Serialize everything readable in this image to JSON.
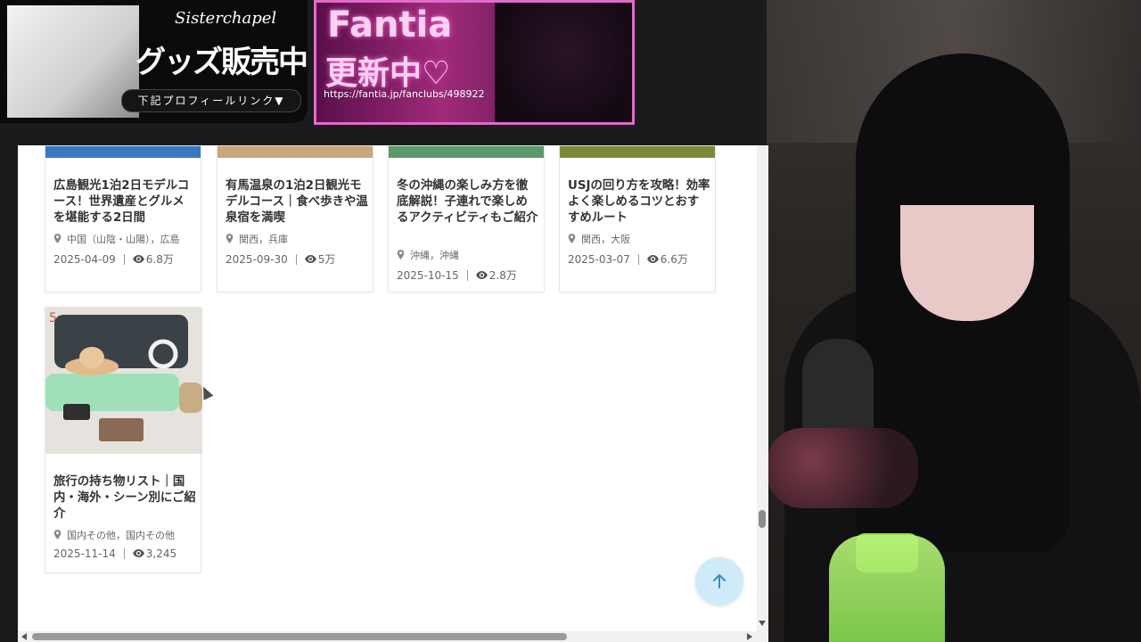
{
  "overlay": {
    "left_banner": {
      "brand": "Sisterchapel",
      "headline": "グッズ販売中",
      "link_text": "下記プロフィールリンク▼"
    },
    "right_banner": {
      "title": "Fantia",
      "subtitle": "更新中♡",
      "url": "https://fantia.jp/fanclubs/498922"
    }
  },
  "articles": [
    {
      "title": "広島観光1泊2日モデルコース！世界遺産とグルメを堪能する2日間",
      "location": "中国（山陰・山陽），広島",
      "date": "2025-04-09",
      "views": "6.8万",
      "strip_color": "#3a78c2"
    },
    {
      "title": "有馬温泉の1泊2日観光モデルコース｜食べ歩きや温泉宿を満喫",
      "location": "関西，兵庫",
      "date": "2025-09-30",
      "views": "5万",
      "strip_color": "#c9a77a"
    },
    {
      "title": "冬の沖縄の楽しみ方を徹底解説！子連れで楽しめるアクティビティもご紹介",
      "location": "沖縄，沖縄",
      "date": "2025-10-15",
      "views": "2.8万",
      "strip_color": "#5a9a6a"
    },
    {
      "title": "USJの回り方を攻略！効率よく楽しめるコツとおすすめルート",
      "location": "関西，大阪",
      "date": "2025-03-07",
      "views": "6.6万",
      "strip_color": "#7a8a3a"
    },
    {
      "rank": "5",
      "title": "旅行の持ち物リスト｜国内・海外・シーン別にご紹介",
      "location": "国内その他，国内その他",
      "date": "2025-11-14",
      "views": "3,245"
    }
  ],
  "icons": {
    "location": "map-pin-icon",
    "views": "eye-icon",
    "scroll_top": "arrow-up-icon"
  }
}
